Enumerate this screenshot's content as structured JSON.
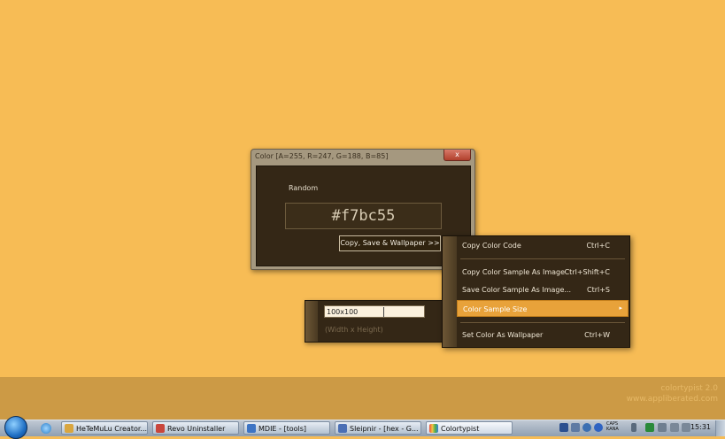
{
  "desktop": {
    "background_color": "#f7bc55"
  },
  "brand": {
    "name": "colortypist 2.0",
    "url": "www.appliberated.com"
  },
  "window": {
    "title": "Color [A=255, R=247, G=188, B=85]",
    "close_glyph": "x",
    "random_label": "Random",
    "hex_value": "#f7bc55",
    "copy_button": "Copy, Save & Wallpaper >>"
  },
  "size_popup": {
    "input_value": "100x100",
    "hint": "(Width x Height)"
  },
  "context_menu": {
    "items": [
      {
        "label": "Copy Color Code",
        "shortcut": "Ctrl+C"
      },
      {
        "label": "Copy Color Sample As Image",
        "shortcut": "Ctrl+Shift+C"
      },
      {
        "label": "Save Color Sample As Image...",
        "shortcut": "Ctrl+S"
      },
      {
        "label": "Color Sample Size",
        "shortcut": "",
        "submenu_arrow": "▸"
      },
      {
        "label": "Set Color As Wallpaper",
        "shortcut": "Ctrl+W"
      }
    ]
  },
  "taskbar": {
    "buttons": [
      {
        "label": "HeTeMuLu Creator...",
        "icon": "app-icon"
      },
      {
        "label": "Revo Uninstaller",
        "icon": "uninstaller-icon"
      },
      {
        "label": "MDIE - [tools]",
        "icon": "browser-icon"
      },
      {
        "label": "Sleipnir - [hex - G...",
        "icon": "browser-icon"
      },
      {
        "label": "Colortypist",
        "icon": "colortypist-icon"
      }
    ],
    "tray_lang_line1": "CAPS",
    "tray_lang_line2": "KANA",
    "clock": "15:31"
  }
}
